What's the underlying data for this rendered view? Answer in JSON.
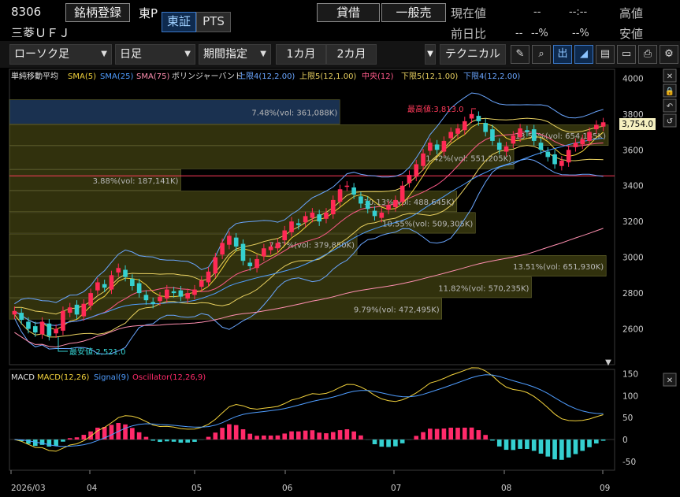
{
  "header": {
    "code": "8306",
    "name": "三菱ＵＦＪ",
    "register_button": "銘柄登録",
    "market_label": "東P",
    "tab_tse": "東証",
    "tab_pts": "PTS",
    "taishaku_button": "貸借",
    "ippan_button": "一般売",
    "current_price_label": "現在値",
    "current_price_value": "--",
    "current_price_time": "--:--",
    "prev_change_label": "前日比",
    "prev_change_value": "--",
    "prev_change_pct": "--%",
    "high_label": "高値",
    "low_label": "安値",
    "low_value": "--"
  },
  "toolbar": {
    "chart_type": "ローソク足",
    "period": "日足",
    "range_mode": "期間指定",
    "range_1m": "1カ月",
    "range_2m": "2カ月",
    "technical": "テクニカル",
    "icons": [
      "pencil-icon",
      "zoom-icon",
      "volume-icon",
      "area-chart-icon",
      "save-icon",
      "open-folder-icon",
      "print-icon",
      "settings-icon"
    ]
  },
  "price_panel": {
    "legend": {
      "title": "単純移動平均",
      "sma5": "SMA(5)",
      "sma25": "SMA(25)",
      "sma75": "SMA(75)",
      "bb_title": "ボリンジャーバンド",
      "upper4": "上限4(12,2.00)",
      "upper5": "上限5(12,1.00)",
      "middle": "中央(12)",
      "lower5": "下限5(12,1.00)",
      "lower4": "下限4(12,2.00)"
    },
    "colors": {
      "sma5": "#f2d23c",
      "sma25": "#4f9dff",
      "sma75": "#ff8fb0",
      "bb_outer": "#6aa6ff",
      "bb_inner": "#e8d060",
      "bb_mid": "#ff5a8a",
      "up": "#ff2a55",
      "down": "#35d0d0",
      "profile_band": "#3a3a10",
      "profile_band_top": "#1f3a5f"
    },
    "y_ticks": [
      "4000",
      "3800",
      "3600",
      "3400",
      "3200",
      "3000",
      "2800",
      "2600"
    ],
    "current_price_tag": "3,754.0",
    "high_annotation": "最高値:3,813.0",
    "low_annotation": "最安値:2,521.0",
    "volume_profile": [
      "7.48%(vol: 361,088K)",
      "13.56%(vol: 654,185K)",
      "11.42%(vol: 551,205K)",
      "3.88%(vol: 187,141K)",
      "10.13%(vol: 488,645K)",
      "10.55%(vol: 509,305K)",
      "7.87%(vol: 379,850K)",
      "13.51%(vol: 651,930K)",
      "11.82%(vol: 570,235K)",
      "9.79%(vol: 472,495K)"
    ]
  },
  "macd_panel": {
    "legend": {
      "title": "MACD",
      "macd": "MACD(12,26)",
      "signal": "Signal(9)",
      "osc": "Oscillator(12,26,9)"
    },
    "colors": {
      "macd": "#f2d23c",
      "signal": "#4f9dff",
      "osc_pos": "#ff2a6a",
      "osc_neg": "#35d0d0"
    },
    "y_ticks": [
      "150",
      "100",
      "50",
      "0",
      "-50"
    ]
  },
  "x_axis": {
    "labels": [
      "2026/03",
      "04",
      "05",
      "06",
      "07",
      "08",
      "09"
    ]
  },
  "chart_data": {
    "type": "candlestick",
    "date_labels": [
      "2026/03",
      "04",
      "05",
      "06",
      "07",
      "08",
      "09"
    ],
    "price_axis_range": [
      2400,
      4050
    ],
    "price_ticks": [
      2600,
      2800,
      3000,
      3200,
      3400,
      3600,
      3800,
      4000
    ],
    "high": 3813.0,
    "low": 2521.0,
    "last": 3754.0,
    "closes": [
      2700,
      2650,
      2600,
      2580,
      2640,
      2560,
      2600,
      2700,
      2720,
      2680,
      2740,
      2800,
      2860,
      2830,
      2900,
      2940,
      2890,
      2840,
      2800,
      2760,
      2740,
      2780,
      2820,
      2800,
      2780,
      2800,
      2820,
      2870,
      2920,
      3000,
      3080,
      3120,
      3060,
      2980,
      2950,
      2990,
      3050,
      3060,
      3080,
      3150,
      3200,
      3180,
      3230,
      3250,
      3200,
      3250,
      3320,
      3380,
      3400,
      3350,
      3300,
      3270,
      3230,
      3250,
      3290,
      3320,
      3400,
      3460,
      3520,
      3580,
      3640,
      3600,
      3650,
      3700,
      3720,
      3760,
      3800,
      3760,
      3700,
      3650,
      3600,
      3620,
      3680,
      3720,
      3700,
      3650,
      3600,
      3560,
      3520,
      3540,
      3600,
      3640,
      3660,
      3700,
      3740,
      3754
    ],
    "volume_profile_pct": [
      7.48,
      13.56,
      11.42,
      3.88,
      10.13,
      10.55,
      7.87,
      13.51,
      11.82,
      9.79
    ],
    "volume_profile_vol_k": [
      361088,
      654185,
      551205,
      187141,
      488645,
      509305,
      379850,
      651930,
      570235,
      472495
    ],
    "macd_axis_range": [
      -70,
      160
    ],
    "macd_ticks": [
      150,
      100,
      50,
      0,
      -50
    ]
  }
}
